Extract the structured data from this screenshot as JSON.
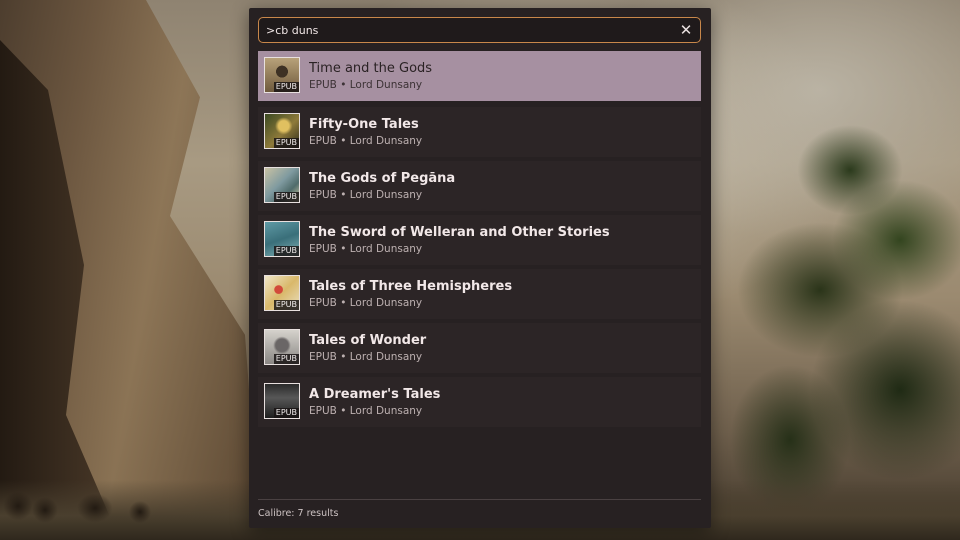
{
  "search": {
    "query": ">cb duns",
    "clear_label": "✕"
  },
  "results": [
    {
      "title": "Time and the Gods",
      "subtitle": "EPUB • Lord Dunsany",
      "badge": "EPUB",
      "selected": true,
      "cover_icon": "book-cover-icon"
    },
    {
      "title": "Fifty-One Tales",
      "subtitle": "EPUB • Lord Dunsany",
      "badge": "EPUB",
      "selected": false,
      "cover_icon": "book-cover-icon"
    },
    {
      "title": "The Gods of Pegāna",
      "subtitle": "EPUB • Lord Dunsany",
      "badge": "EPUB",
      "selected": false,
      "cover_icon": "book-cover-icon"
    },
    {
      "title": "The Sword of Welleran and Other Stories",
      "subtitle": "EPUB • Lord Dunsany",
      "badge": "EPUB",
      "selected": false,
      "cover_icon": "book-cover-icon"
    },
    {
      "title": "Tales of Three Hemispheres",
      "subtitle": "EPUB • Lord Dunsany",
      "badge": "EPUB",
      "selected": false,
      "cover_icon": "book-cover-icon"
    },
    {
      "title": "Tales of Wonder",
      "subtitle": "EPUB • Lord Dunsany",
      "badge": "EPUB",
      "selected": false,
      "cover_icon": "book-cover-icon"
    },
    {
      "title": "A Dreamer's Tales",
      "subtitle": "EPUB • Lord Dunsany",
      "badge": "EPUB",
      "selected": false,
      "cover_icon": "book-cover-icon"
    }
  ],
  "status": "Calibre: 7 results",
  "colors": {
    "panel": "#272122",
    "row": "#2c2526",
    "selected_row": "#a690a1",
    "search_border": "#c8874a"
  }
}
